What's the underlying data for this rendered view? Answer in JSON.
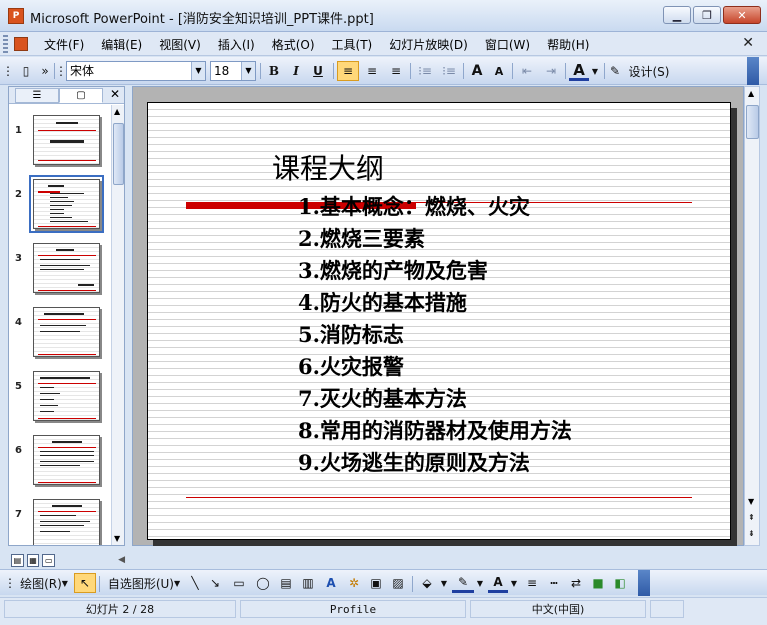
{
  "window": {
    "app_icon": "P",
    "title": "Microsoft PowerPoint - [消防安全知识培训_PPT课件.ppt]",
    "min_glyph": "▁",
    "max_glyph": "❐",
    "close_glyph": "✕"
  },
  "menu": {
    "items": [
      "文件(F)",
      "编辑(E)",
      "视图(V)",
      "插入(I)",
      "格式(O)",
      "工具(T)",
      "幻灯片放映(D)",
      "窗口(W)",
      "帮助(H)"
    ],
    "close_glyph": "✕"
  },
  "toolbar": {
    "font_name": "宋体",
    "font_size": "18",
    "bold": "B",
    "italic": "I",
    "underline": "U",
    "design_label": "设计(S)",
    "font_color_glyph": "A",
    "grow_glyph": "A",
    "shrink_glyph": "A"
  },
  "outline_pane": {
    "tab_outline_glyph": "☰",
    "tab_slides_glyph": "▢",
    "close_glyph": "✕",
    "slide_numbers": [
      "1",
      "2",
      "3",
      "4",
      "5",
      "6",
      "7"
    ],
    "selected_slide": 2
  },
  "slide": {
    "title": "课程大纲",
    "items": [
      "1.基本概念：燃烧、火灾",
      "2.燃烧三要素",
      "3.燃烧的产物及危害",
      "4.防火的基本措施",
      "5.消防标志",
      "6.火灾报警",
      "7.灭火的基本方法",
      "8.常用的消防器材及使用方法",
      "9.火场逃生的原则及方法"
    ]
  },
  "drawbar": {
    "draw_label": "绘图(R)",
    "autoshape_label": "自选图形(U)"
  },
  "status": {
    "slide_info": "幻灯片 2 / 28",
    "design": "Profile",
    "language": "中文(中国)"
  }
}
